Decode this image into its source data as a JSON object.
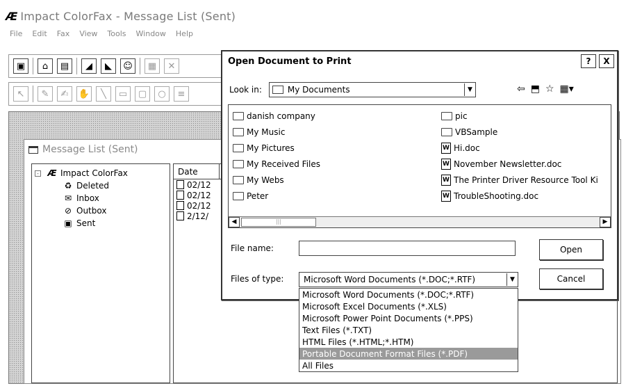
{
  "app": {
    "title": "Impact ColorFax - Message List (Sent)",
    "logo": "Æ"
  },
  "menu": [
    "File",
    "Edit",
    "Fax",
    "View",
    "Tools",
    "Window",
    "Help"
  ],
  "toolbar": {
    "row1_icons": [
      "fax-window-icon",
      "open-icon",
      "save-icon",
      "send-fax-icon",
      "receive-fax-icon",
      "phonebook-icon",
      "preview-icon",
      "close-icon"
    ],
    "row2_icons": [
      "pointer-icon",
      "pen-icon",
      "text-edit-icon",
      "hand-icon",
      "line-icon",
      "rectangle-icon",
      "rounded-rect-icon",
      "ellipse-icon",
      "text-tool-icon"
    ]
  },
  "message_list": {
    "title": "Message List (Sent)",
    "tree": {
      "root": "Impact ColorFax",
      "expander": "-",
      "children": [
        "Deleted",
        "Inbox",
        "Outbox",
        "Sent"
      ]
    },
    "columns": [
      "Date"
    ],
    "rows": [
      "02/12",
      "02/12",
      "02/12",
      "2/12/"
    ]
  },
  "dialog": {
    "title": "Open Document to Print",
    "help_btn": "?",
    "close_btn": "X",
    "look_in_label": "Look in:",
    "look_in_value": "My Documents",
    "files_left": [
      {
        "name": "danish company",
        "type": "folder"
      },
      {
        "name": "My Music",
        "type": "folder"
      },
      {
        "name": "My Pictures",
        "type": "folder"
      },
      {
        "name": "My Received Files",
        "type": "folder"
      },
      {
        "name": "My Webs",
        "type": "folder"
      },
      {
        "name": "Peter",
        "type": "folder"
      }
    ],
    "files_right": [
      {
        "name": "pic",
        "type": "folder"
      },
      {
        "name": "VBSample",
        "type": "folder"
      },
      {
        "name": "Hi.doc",
        "type": "doc"
      },
      {
        "name": "November Newsletter.doc",
        "type": "doc"
      },
      {
        "name": "The Printer Driver Resource Tool Ki",
        "type": "doc"
      },
      {
        "name": "TroubleShooting.doc",
        "type": "doc"
      }
    ],
    "file_name_label": "File name:",
    "file_name_value": "",
    "files_of_type_label": "Files of type:",
    "files_of_type_value": "Microsoft Word Documents (*.DOC;*.RTF)",
    "open_btn": "Open",
    "cancel_btn": "Cancel",
    "type_options": [
      "Microsoft Word Documents (*.DOC;*.RTF)",
      "Microsoft Excel Documents (*.XLS)",
      "Microsoft Power Point Documents (*.PPS)",
      "Text Files (*.TXT)",
      "HTML Files (*.HTML;*.HTM)",
      "Portable Document Format Files (*.PDF)",
      "All Files"
    ],
    "selected_type_index": 5
  }
}
